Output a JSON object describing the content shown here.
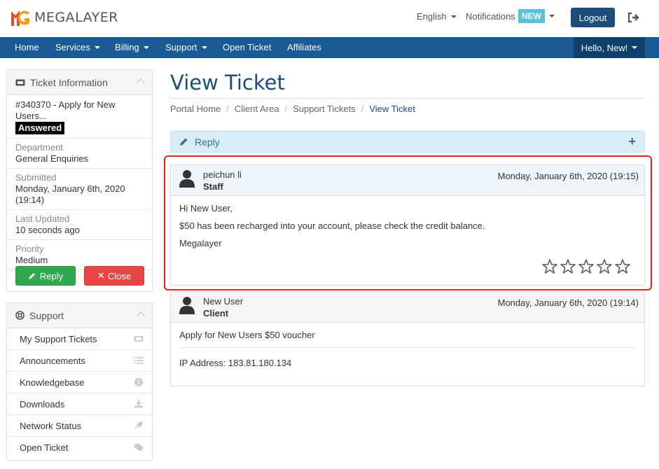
{
  "brand": {
    "name": "MEGALAYER",
    "logo_colors": [
      "#e84b2c",
      "#f39c12"
    ]
  },
  "header": {
    "language": "English",
    "notifications": "Notifications",
    "notifications_badge": "NEW",
    "logout": "Logout"
  },
  "nav": {
    "items": [
      {
        "label": "Home"
      },
      {
        "label": "Services"
      },
      {
        "label": "Billing"
      },
      {
        "label": "Support"
      },
      {
        "label": "Open Ticket"
      },
      {
        "label": "Affiliates"
      }
    ],
    "account": "Hello, New!"
  },
  "ticket_info": {
    "title": "Ticket Information",
    "subject": "#340370 - Apply for New Users...",
    "status": "Answered",
    "department_label": "Department",
    "department": "General Enquiries",
    "submitted_label": "Submitted",
    "submitted_line1": "Monday, January 6th, 2020",
    "submitted_line2": "(19:14)",
    "last_updated_label": "Last Updated",
    "last_updated": "10 seconds ago",
    "priority_label": "Priority",
    "priority": "Medium",
    "reply_button": "Reply",
    "close_button": "Close"
  },
  "support_panel": {
    "title": "Support",
    "items": [
      {
        "label": "My Support Tickets",
        "icon": "ticket-icon"
      },
      {
        "label": "Announcements",
        "icon": "list-icon"
      },
      {
        "label": "Knowledgebase",
        "icon": "info-icon"
      },
      {
        "label": "Downloads",
        "icon": "download-icon"
      },
      {
        "label": "Network Status",
        "icon": "rocket-icon"
      },
      {
        "label": "Open Ticket",
        "icon": "comments-icon"
      }
    ]
  },
  "main": {
    "page_title": "View Ticket",
    "breadcrumb": [
      "Portal Home",
      "Client Area",
      "Support Tickets",
      "View Ticket"
    ],
    "reply_bar": "Reply"
  },
  "messages": [
    {
      "author": "peichun li",
      "role": "Staff",
      "date": "Monday, January 6th, 2020 (19:15)",
      "lines": [
        "Hi New User,",
        "$50 has been recharged into your account, please check the credit balance.",
        "Megalayer"
      ],
      "rating_stars": 5
    },
    {
      "author": "New User",
      "role": "Client",
      "date": "Monday, January 6th, 2020 (19:14)",
      "lines": [
        "Apply for New Users $50 voucher"
      ],
      "ip": "IP Address: 183.81.180.134"
    }
  ]
}
